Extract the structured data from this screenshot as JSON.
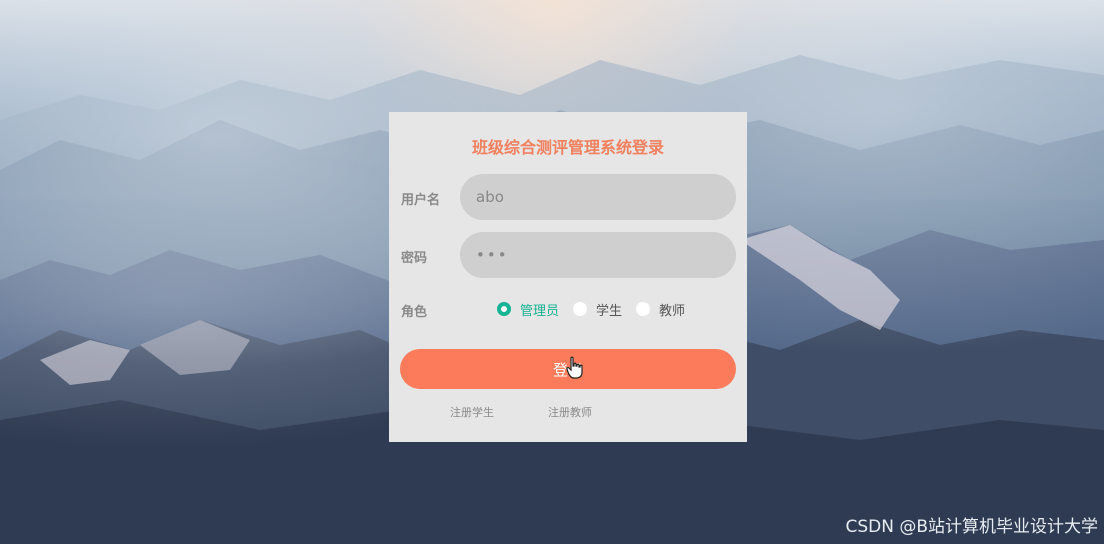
{
  "login": {
    "title": "班级综合测评管理系统登录",
    "username_label": "用户名",
    "username_value": "abo",
    "password_label": "密码",
    "password_value": "•••",
    "role_label": "角色",
    "roles": [
      {
        "label": "管理员",
        "checked": true
      },
      {
        "label": "学生",
        "checked": false
      },
      {
        "label": "教师",
        "checked": false
      }
    ],
    "login_button": "登录",
    "register_student": "注册学生",
    "register_teacher": "注册教师"
  },
  "watermark": "CSDN @B站计算机毕业设计大学",
  "colors": {
    "accent": "#fb7b5a",
    "title": "#f0805e",
    "radio_checked": "#16b394",
    "card_bg": "#e6e6e6",
    "field_bg": "#cfcfcf"
  },
  "icons": {
    "cursor": "hand-pointer-icon"
  }
}
